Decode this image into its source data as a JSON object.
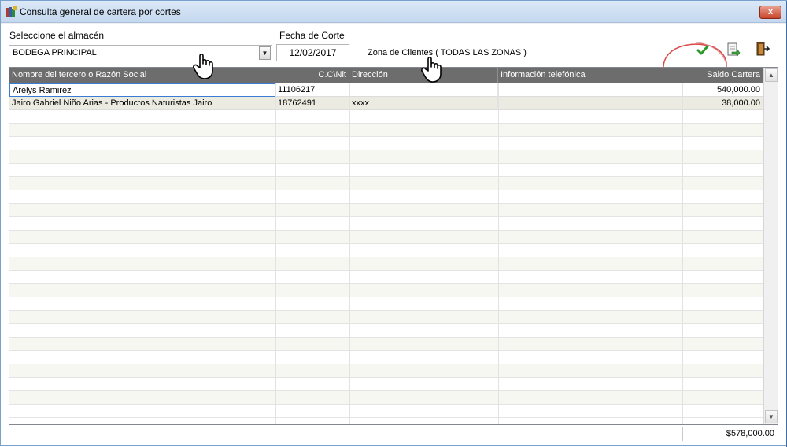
{
  "window": {
    "title": "Consulta general de cartera por cortes",
    "close_label": "x"
  },
  "filters": {
    "warehouse_label": "Seleccione el almacén",
    "warehouse_value": "BODEGA PRINCIPAL",
    "cutoff_label": "Fecha de Corte",
    "cutoff_value": "12/02/2017",
    "zone_text": "Zona de Clientes ( TODAS LAS ZONAS )"
  },
  "toolbar": {
    "accept_icon": "check-icon",
    "export_icon": "export-document-icon",
    "exit_icon": "exit-door-icon"
  },
  "grid": {
    "columns": [
      "Nombre del tercero o Razón Social",
      "C.C\\Nit",
      "Dirección",
      "Información telefónica",
      "Saldo Cartera"
    ],
    "rows": [
      {
        "name": "Arelys Ramirez",
        "id": "11106217",
        "address": "",
        "phone": "",
        "balance": "540,000.00"
      },
      {
        "name": "Jairo Gabriel Niño Arias - Productos Naturistas Jairo",
        "id": "18762491",
        "address": "xxxx",
        "phone": "",
        "balance": "38,000.00"
      }
    ]
  },
  "total": "$578,000.00",
  "colors": {
    "header_bg": "#6d6d6d",
    "alt_row": "#ecebe1",
    "annotation_circle": "#d94a4a"
  }
}
